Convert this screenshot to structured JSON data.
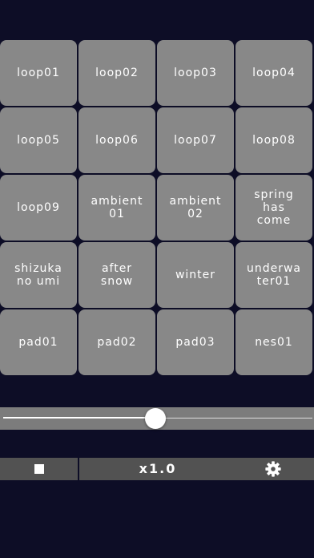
{
  "colors": {
    "background": "#0d0d26",
    "pad": "#888888",
    "pad_text": "#ffffff",
    "slider_band": "#7c7c7c",
    "bottom_bar": "#525252"
  },
  "pads": [
    {
      "label": "loop01"
    },
    {
      "label": "loop02"
    },
    {
      "label": "loop03"
    },
    {
      "label": "loop04"
    },
    {
      "label": "loop05"
    },
    {
      "label": "loop06"
    },
    {
      "label": "loop07"
    },
    {
      "label": "loop08"
    },
    {
      "label": "loop09"
    },
    {
      "label": "ambient\n01"
    },
    {
      "label": "ambient\n02"
    },
    {
      "label": "spring\nhas\ncome"
    },
    {
      "label": "shizuka\nno umi"
    },
    {
      "label": "after\nsnow"
    },
    {
      "label": "winter"
    },
    {
      "label": "underwa\nter01"
    },
    {
      "label": "pad01"
    },
    {
      "label": "pad02"
    },
    {
      "label": "pad03"
    },
    {
      "label": "nes01"
    }
  ],
  "slider": {
    "value": 0.5
  },
  "bottom_bar": {
    "stop_icon": "stop-icon",
    "speed_label": "x1.0",
    "settings_icon": "gear-icon"
  }
}
